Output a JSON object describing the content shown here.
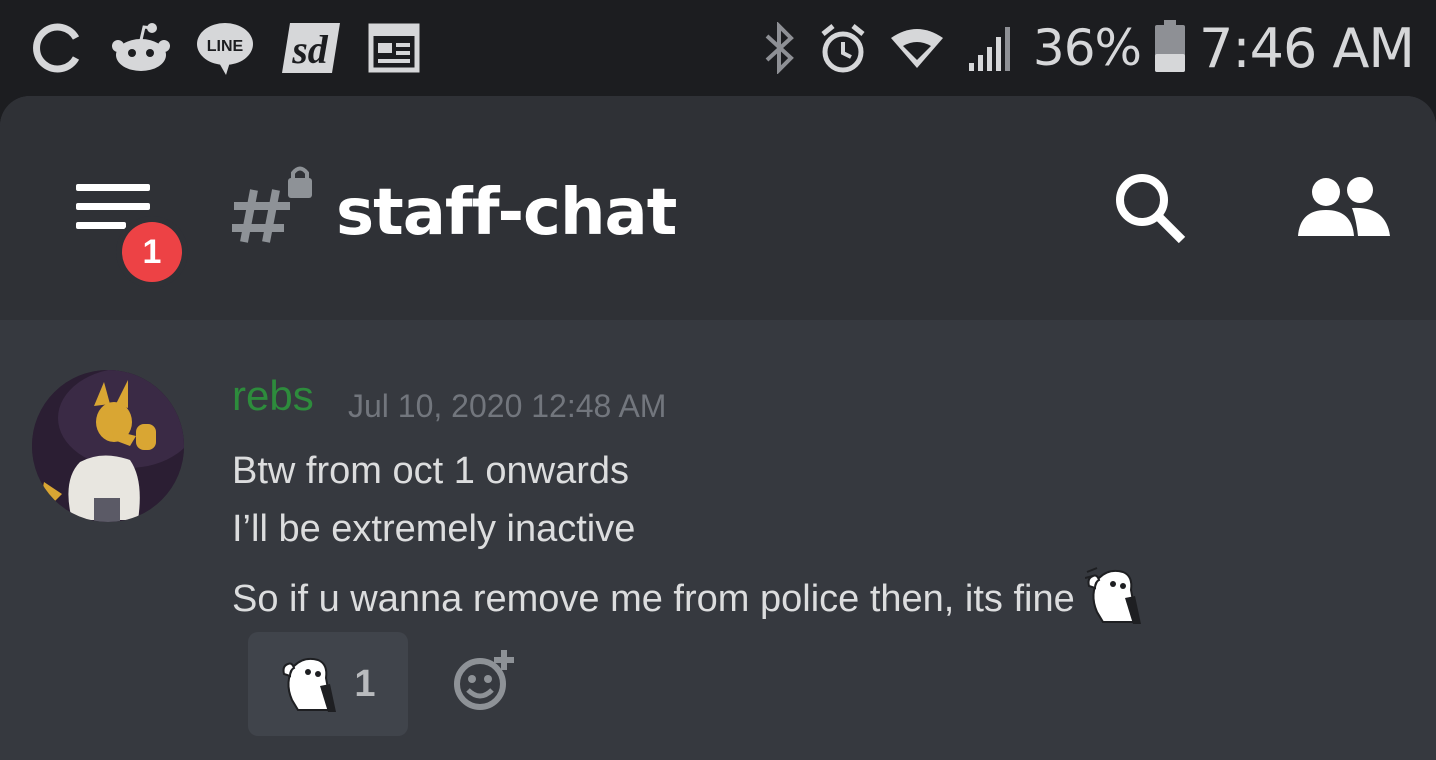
{
  "status_bar": {
    "left_icons": [
      "sync-icon",
      "reddit-icon",
      "line-icon",
      "sd-icon",
      "news-icon"
    ],
    "right_icons": [
      "bluetooth-icon",
      "alarm-icon",
      "wifi-icon",
      "signal-icon"
    ],
    "battery_percent": "36%",
    "time": "7:46 AM"
  },
  "header": {
    "notification_count": "1",
    "channel_name": "staff-chat",
    "channel_icon": "locked-hash-icon"
  },
  "message": {
    "author": "rebs",
    "timestamp": "Jul 10, 2020 12:48 AM",
    "lines": [
      "Btw from oct 1 onwards",
      "I’ll be extremely inactive",
      "So if u wanna remove me from police then, its fine"
    ],
    "reaction_count": "1"
  },
  "colors": {
    "background": "#36393f",
    "header": "#2f3136",
    "statusbar": "#1c1d20",
    "author": "#2d8c3c",
    "badge": "#ed4245",
    "text": "#dcddde",
    "muted": "#72767d"
  }
}
